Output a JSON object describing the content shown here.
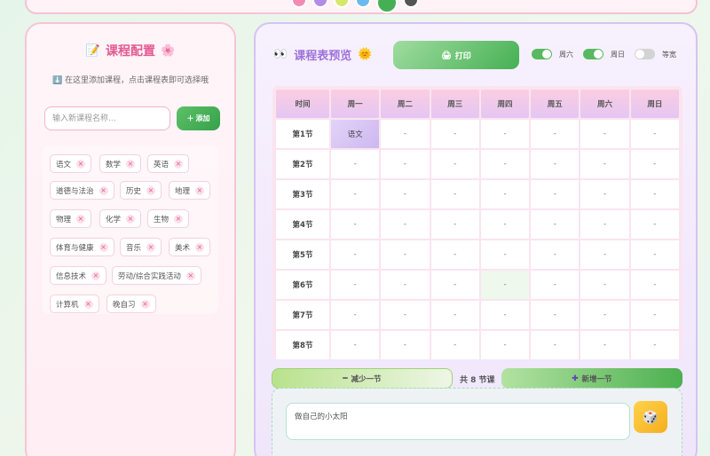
{
  "colors": {
    "accent_pink": "#e25b93",
    "accent_purple": "#9f73d8",
    "accent_green": "#45b053"
  },
  "left": {
    "title": "课程配置",
    "tip": "在这里添加课程，点击课程表即可选择哦",
    "input_placeholder": "输入新课程名称...",
    "add_label": "添加",
    "courses": [
      "语文",
      "数学",
      "英语",
      "道德与法治",
      "历史",
      "地理",
      "物理",
      "化学",
      "生物",
      "体育与健康",
      "音乐",
      "美术",
      "信息技术",
      "劳动/综合实践活动",
      "计算机",
      "晚自习"
    ]
  },
  "right": {
    "title": "课程表预览",
    "print_label": "打印",
    "toggles": [
      {
        "label": "周六",
        "on": true
      },
      {
        "label": "周日",
        "on": true
      },
      {
        "label": "等宽",
        "on": false
      }
    ],
    "headers": [
      "时间",
      "周一",
      "周二",
      "周三",
      "周四",
      "周五",
      "周六",
      "周日"
    ],
    "rows": [
      {
        "period": "第1节",
        "cells": [
          "语文",
          "-",
          "-",
          "-",
          "-",
          "-",
          "-"
        ]
      },
      {
        "period": "第2节",
        "cells": [
          "-",
          "-",
          "-",
          "-",
          "-",
          "-",
          "-"
        ]
      },
      {
        "period": "第3节",
        "cells": [
          "-",
          "-",
          "-",
          "-",
          "-",
          "-",
          "-"
        ]
      },
      {
        "period": "第4节",
        "cells": [
          "-",
          "-",
          "-",
          "-",
          "-",
          "-",
          "-"
        ]
      },
      {
        "period": "第5节",
        "cells": [
          "-",
          "-",
          "-",
          "-",
          "-",
          "-",
          "-"
        ]
      },
      {
        "period": "第6节",
        "cells": [
          "-",
          "-",
          "-",
          "-",
          "-",
          "-",
          "-"
        ]
      },
      {
        "period": "第7节",
        "cells": [
          "-",
          "-",
          "-",
          "-",
          "-",
          "-",
          "-"
        ]
      },
      {
        "period": "第8节",
        "cells": [
          "-",
          "-",
          "-",
          "-",
          "-",
          "-",
          "-"
        ]
      }
    ],
    "minus_label": "减少一节",
    "count_label": "共 8 节课",
    "plus_label": "新增一节",
    "motto_value": "做自己的小太阳"
  }
}
